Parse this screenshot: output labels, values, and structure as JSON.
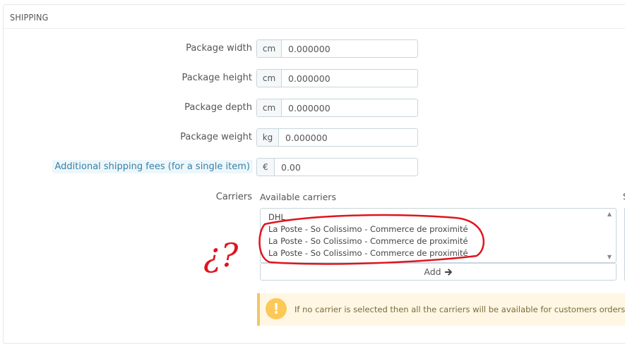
{
  "panel": {
    "title": "SHIPPING"
  },
  "fields": [
    {
      "label": "Package width",
      "unit": "cm",
      "value": "0.000000"
    },
    {
      "label": "Package height",
      "unit": "cm",
      "value": "0.000000"
    },
    {
      "label": "Package depth",
      "unit": "cm",
      "value": "0.000000"
    },
    {
      "label": "Package weight",
      "unit": "kg",
      "value": "0.000000"
    }
  ],
  "fee": {
    "label": "Additional shipping fees (for a single item)",
    "unit": "€",
    "value": "0.00"
  },
  "carriers": {
    "label": "Carriers",
    "available_label": "Available carriers",
    "items": [
      "DHL",
      "La Poste - So Colissimo - Commerce de proximité",
      "La Poste - So Colissimo - Commerce de proximité",
      "La Poste - So Colissimo - Commerce de proximité"
    ],
    "add_label": "Add",
    "add_icon": "arrow-right-icon",
    "right_column_fragment": "S"
  },
  "alert": {
    "icon": "exclamation-icon",
    "text": "If no carrier is selected then all the carriers will be available for customers orders."
  },
  "annotation": {
    "text": "¿?",
    "color": "#e0141e"
  }
}
